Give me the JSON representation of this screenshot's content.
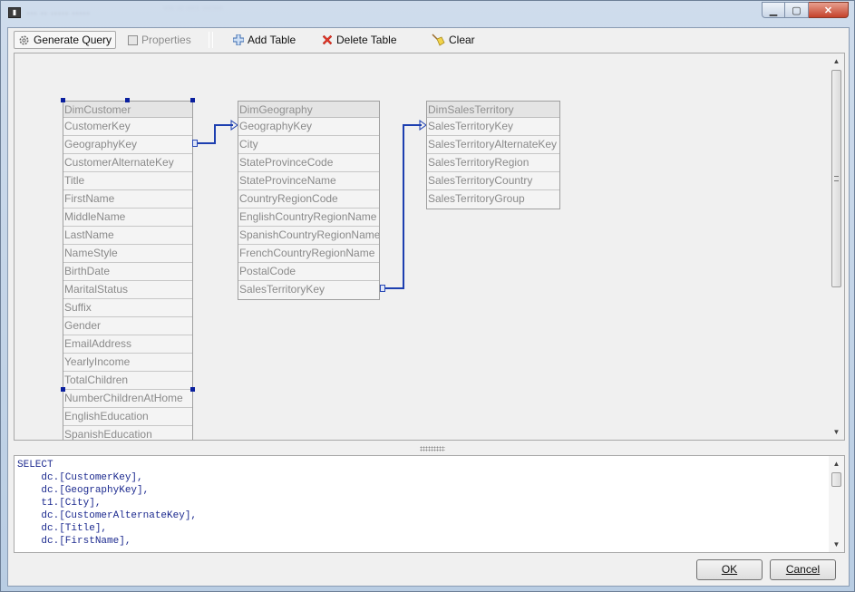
{
  "window": {
    "title": "··· ·· ····· ·····",
    "title_secondary": "··· ·· ···· ······",
    "icon": "app-icon",
    "controls": {
      "minimize": "minimize-icon",
      "maximize": "maximize-icon",
      "close": "close-icon"
    }
  },
  "toolbar": {
    "generate_query": "Generate Query",
    "properties": "Properties",
    "add_table": "Add Table",
    "delete_table": "Delete Table",
    "clear": "Clear"
  },
  "tables": [
    {
      "name": "DimCustomer",
      "selected": true,
      "columns": [
        "CustomerKey",
        "GeographyKey",
        "CustomerAlternateKey",
        "Title",
        "FirstName",
        "MiddleName",
        "LastName",
        "NameStyle",
        "BirthDate",
        "MaritalStatus",
        "Suffix",
        "Gender",
        "EmailAddress",
        "YearlyIncome",
        "TotalChildren",
        "NumberChildrenAtHome",
        "EnglishEducation",
        "SpanishEducation"
      ]
    },
    {
      "name": "DimGeography",
      "selected": false,
      "columns": [
        "GeographyKey",
        "City",
        "StateProvinceCode",
        "StateProvinceName",
        "CountryRegionCode",
        "EnglishCountryRegionName",
        "SpanishCountryRegionName",
        "FrenchCountryRegionName",
        "PostalCode",
        "SalesTerritoryKey"
      ]
    },
    {
      "name": "DimSalesTerritory",
      "selected": false,
      "columns": [
        "SalesTerritoryKey",
        "SalesTerritoryAlternateKey",
        "SalesTerritoryRegion",
        "SalesTerritoryCountry",
        "SalesTerritoryGroup"
      ]
    }
  ],
  "relations": [
    {
      "from": "DimCustomer.GeographyKey",
      "to": "DimGeography.GeographyKey"
    },
    {
      "from": "DimGeography.SalesTerritoryKey",
      "to": "DimSalesTerritory.SalesTerritoryKey"
    }
  ],
  "sql": {
    "text": "SELECT\n    dc.[CustomerKey],\n    dc.[GeographyKey],\n    t1.[City],\n    dc.[CustomerAlternateKey],\n    dc.[Title],\n    dc.[FirstName],"
  },
  "buttons": {
    "ok": "OK",
    "cancel": "Cancel"
  },
  "colors": {
    "link": "#1d3fb0",
    "selection_handle": "#0a1f9e",
    "sql_text": "#1c2a8f"
  }
}
